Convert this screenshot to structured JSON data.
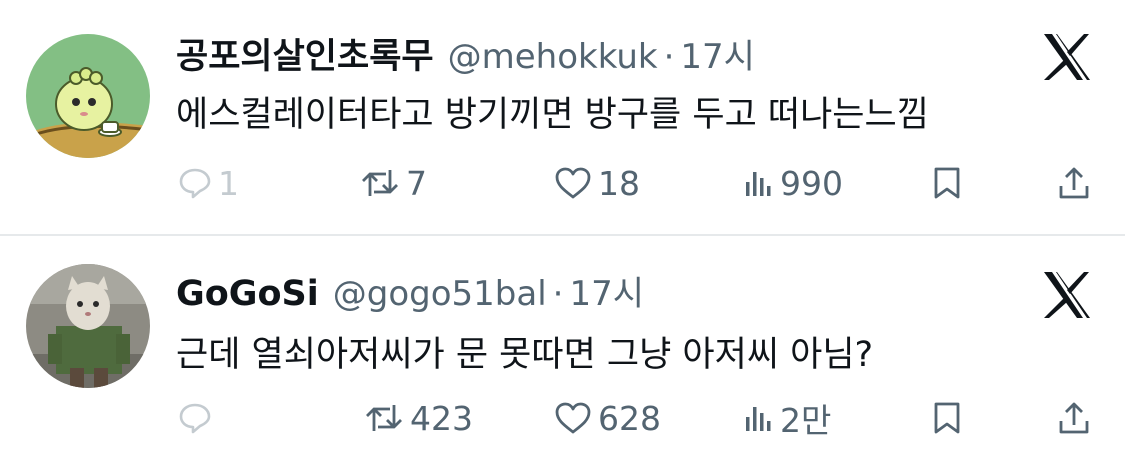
{
  "tweets": [
    {
      "name": "공포의살인초록무",
      "handle": "@mehokkuk",
      "separator": "·",
      "time": "17시",
      "text": "에스컬레이터타고 방기끼면  방구를 두고 떠나는느낌",
      "replies": "1",
      "retweets": "7",
      "likes": "18",
      "views": "990"
    },
    {
      "name": "GoGoSi",
      "handle": "@gogo51bal",
      "separator": "·",
      "time": "17시",
      "text": "근데 열쇠아저씨가 문 못따면 그냥 아저씨 아님?",
      "replies": "",
      "retweets": "423",
      "likes": "628",
      "views": "2만"
    }
  ],
  "icons": {
    "platform_logo": "x-logo-icon",
    "reply": "reply-icon",
    "retweet": "retweet-icon",
    "like": "heart-icon",
    "views": "views-chart-icon",
    "bookmark": "bookmark-icon",
    "share": "share-icon"
  },
  "colors": {
    "text": "#0f1419",
    "secondary": "#536471",
    "divider": "#e6e9eb",
    "faded": "#c4cbd0"
  }
}
